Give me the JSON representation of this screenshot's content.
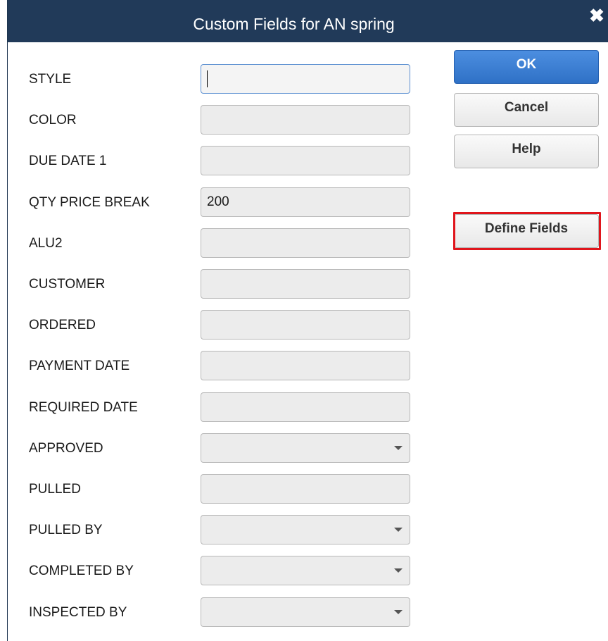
{
  "window": {
    "title": "Custom Fields for AN spring",
    "close_glyph": "✖"
  },
  "fields": [
    {
      "label": "STYLE",
      "value": "",
      "type": "text",
      "focused": true
    },
    {
      "label": "COLOR",
      "value": "",
      "type": "text"
    },
    {
      "label": "DUE DATE 1",
      "value": "",
      "type": "text"
    },
    {
      "label": "QTY PRICE BREAK",
      "value": "200",
      "type": "text"
    },
    {
      "label": "ALU2",
      "value": "",
      "type": "text"
    },
    {
      "label": "CUSTOMER",
      "value": "",
      "type": "text"
    },
    {
      "label": "ORDERED",
      "value": "",
      "type": "text"
    },
    {
      "label": "PAYMENT DATE",
      "value": "",
      "type": "text"
    },
    {
      "label": "REQUIRED DATE",
      "value": "",
      "type": "text"
    },
    {
      "label": "APPROVED",
      "value": "",
      "type": "dropdown"
    },
    {
      "label": "PULLED",
      "value": "",
      "type": "text"
    },
    {
      "label": "PULLED BY",
      "value": "",
      "type": "dropdown"
    },
    {
      "label": "COMPLETED BY",
      "value": "",
      "type": "dropdown"
    },
    {
      "label": "INSPECTED BY",
      "value": "",
      "type": "dropdown"
    }
  ],
  "buttons": {
    "ok": "OK",
    "cancel": "Cancel",
    "help": "Help",
    "define_fields": "Define Fields"
  },
  "colors": {
    "titlebar": "#213a59",
    "primary_button": "#2f71c6",
    "highlight": "#e0151c"
  }
}
